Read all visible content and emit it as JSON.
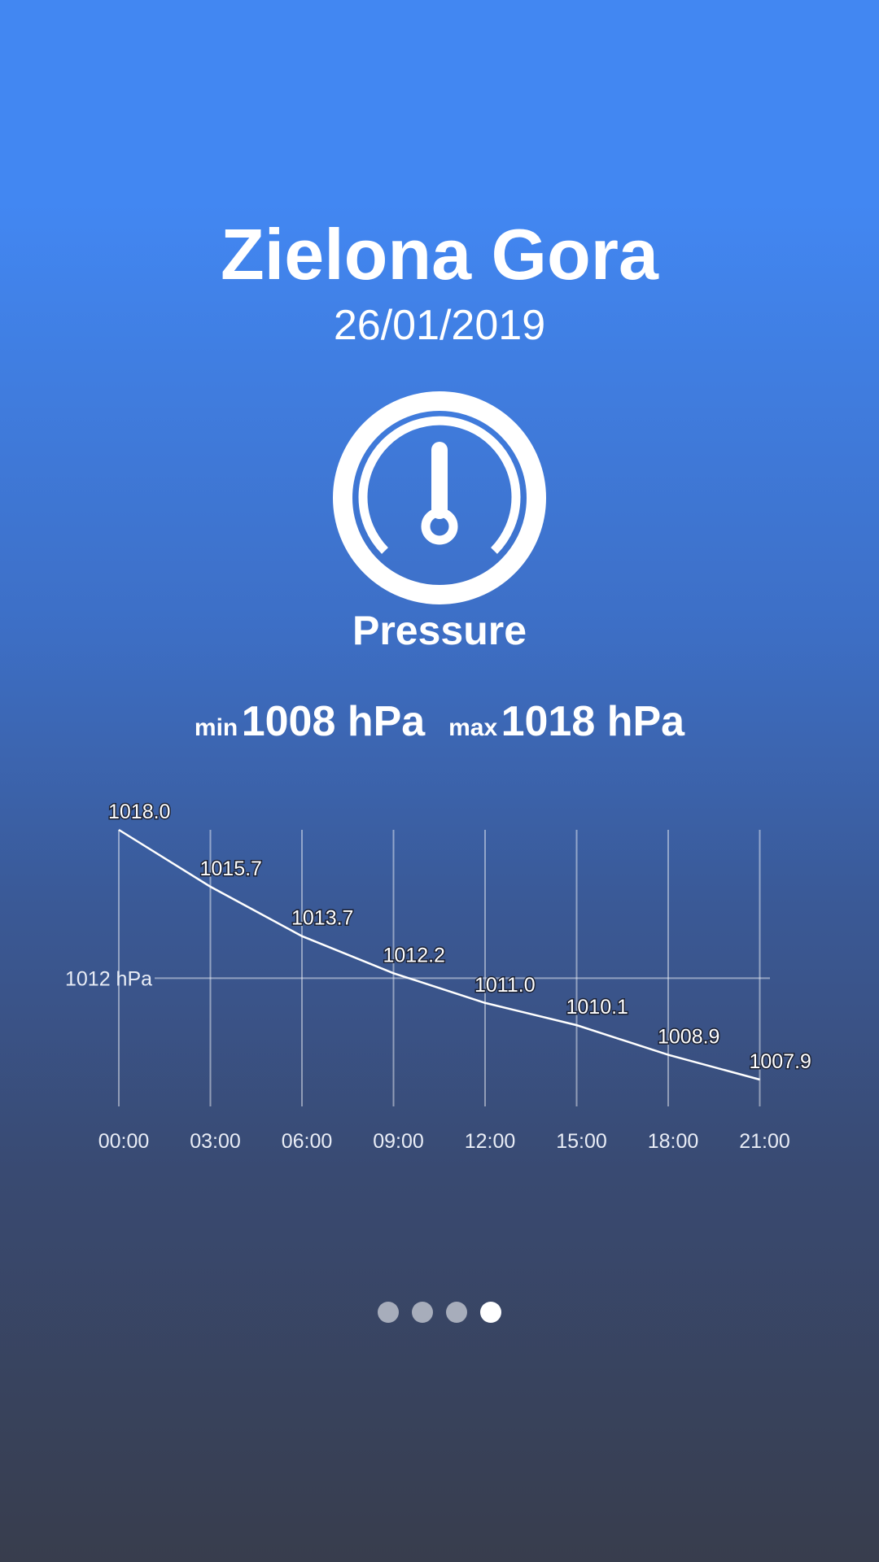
{
  "city": "Zielona Gora",
  "date": "26/01/2019",
  "metric": {
    "label": "Pressure",
    "icon": "pressure-gauge-icon"
  },
  "summary": {
    "min_label": "min",
    "min_value": "1008 hPa",
    "max_label": "max",
    "max_value": "1018 hPa"
  },
  "chart_data": {
    "type": "line",
    "x": [
      "00:00",
      "03:00",
      "06:00",
      "09:00",
      "12:00",
      "15:00",
      "18:00",
      "21:00"
    ],
    "values": [
      1018.0,
      1015.7,
      1013.7,
      1012.2,
      1011.0,
      1010.1,
      1008.9,
      1007.9
    ],
    "value_labels": [
      "1018.0",
      "1015.7",
      "1013.7",
      "1012.2",
      "1011.0",
      "1010.1",
      "1008.9",
      "1007.9"
    ],
    "reference_line": {
      "value": 1012,
      "label": "1012 hPa"
    },
    "grid": "vertical lines at each x tick",
    "line_color": "#ffffff"
  },
  "pager": {
    "count": 4,
    "active_index": 3
  },
  "colors": {
    "bg_top": "#4287f2",
    "bg_bottom": "#383d4d",
    "accent": "#ffffff"
  }
}
